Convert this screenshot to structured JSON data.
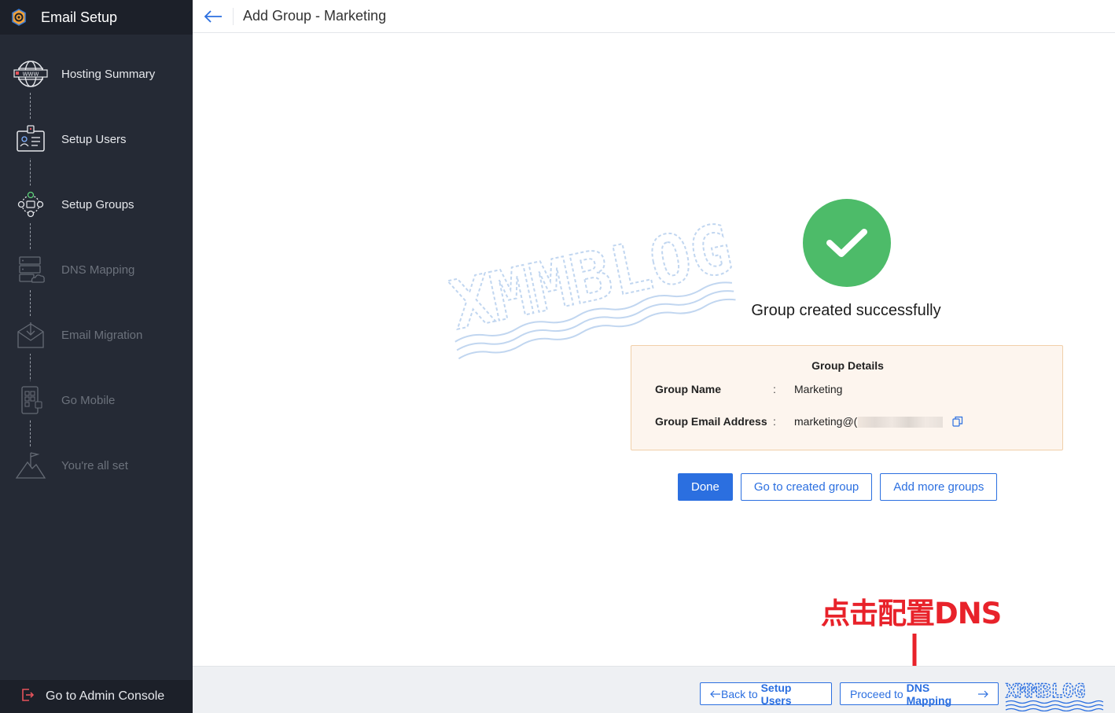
{
  "sidebar": {
    "title": "Email Setup",
    "steps": [
      {
        "label": "Hosting Summary",
        "icon": "globe-www-icon",
        "state": "done"
      },
      {
        "label": "Setup Users",
        "icon": "id-card-icon",
        "state": "done"
      },
      {
        "label": "Setup Groups",
        "icon": "group-network-icon",
        "state": "done"
      },
      {
        "label": "DNS Mapping",
        "icon": "server-cloud-icon",
        "state": "todo"
      },
      {
        "label": "Email Migration",
        "icon": "mail-download-icon",
        "state": "todo"
      },
      {
        "label": "Go Mobile",
        "icon": "mobile-apps-icon",
        "state": "todo"
      },
      {
        "label": "You're all set",
        "icon": "mountain-flag-icon",
        "state": "todo"
      }
    ],
    "footer_label": "Go to Admin Console"
  },
  "header": {
    "title": "Add Group - Marketing"
  },
  "main": {
    "success_message": "Group created successfully",
    "details": {
      "heading": "Group Details",
      "rows": [
        {
          "key": "Group Name",
          "sep": ":",
          "value": "Marketing"
        },
        {
          "key": "Group Email Address",
          "sep": ":",
          "value": "marketing@("
        }
      ]
    },
    "buttons": {
      "done": "Done",
      "go_to_group": "Go to created group",
      "add_more": "Add more groups"
    },
    "annotation": "点击配置DNS",
    "watermark": "XMMBLOG"
  },
  "footer": {
    "back_prefix": "Back to ",
    "back_target": "Setup Users",
    "proceed_prefix": "Proceed to ",
    "proceed_target": "DNS Mapping",
    "watermark": "XMMBLOG"
  },
  "colors": {
    "sidebar_bg": "#252a35",
    "accent": "#2b6fe0",
    "success": "#4dbb69",
    "annotation": "#e8222a",
    "details_bg": "#fdf5ee"
  }
}
